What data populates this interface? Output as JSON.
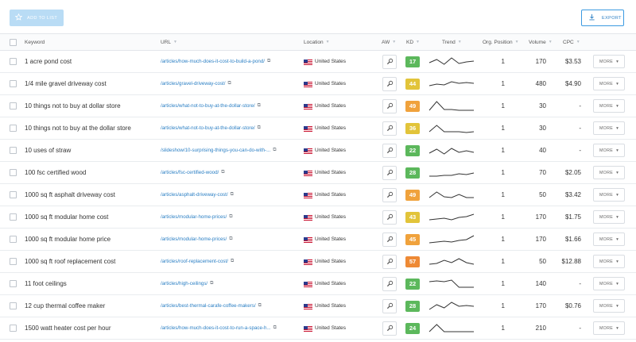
{
  "toolbar": {
    "add_label": "ADD TO LIST",
    "export_label": "EXPORT",
    "add_icon": "star-icon",
    "export_icon": "download-icon"
  },
  "columns": {
    "keyword": "Keyword",
    "url": "URL",
    "location": "Location",
    "aw": "AW",
    "kd": "KD",
    "trend": "Trend",
    "position": "Org. Position",
    "volume": "Volume",
    "cpc": "CPC"
  },
  "colors": {
    "kd_green": "#5cb85c",
    "kd_yellow": "#e2c43a",
    "kd_orange": "#f0a23c",
    "kd_dark_orange": "#ee8a35",
    "link": "#2b7fc4"
  },
  "more_label": "MORE",
  "rows": [
    {
      "keyword": "1 acre pond cost",
      "url": "/articles/how-much-does-it-cost-to-build-a-pond/",
      "location": "United States",
      "kd": "17",
      "kd_color": "#5cb85c",
      "position": "1",
      "volume": "170",
      "cpc": "$3.53",
      "trend": [
        6,
        10,
        4,
        12,
        5,
        7,
        8
      ]
    },
    {
      "keyword": "1/4 mile gravel driveway cost",
      "url": "/articles/gravel-driveway-cost/",
      "location": "United States",
      "kd": "44",
      "kd_color": "#e2c43a",
      "position": "1",
      "volume": "480",
      "cpc": "$4.90",
      "trend": [
        5,
        7,
        6,
        10,
        8,
        9,
        8
      ]
    },
    {
      "keyword": "10 things not to buy at dollar store",
      "url": "/articles/what-not-to-buy-at-the-dollar-store/",
      "location": "United States",
      "kd": "49",
      "kd_color": "#f0a23c",
      "position": "1",
      "volume": "30",
      "cpc": "-",
      "trend": [
        2,
        13,
        3,
        3,
        2,
        2,
        2
      ]
    },
    {
      "keyword": "10 things not to buy at the dollar store",
      "url": "/articles/what-not-to-buy-at-the-dollar-store/",
      "location": "United States",
      "kd": "36",
      "kd_color": "#e2c43a",
      "position": "1",
      "volume": "30",
      "cpc": "-",
      "trend": [
        3,
        11,
        3,
        3,
        3,
        2,
        3
      ]
    },
    {
      "keyword": "10 uses of straw",
      "url": "/slideshow/10-surprising-things-you-can-do-with-...",
      "location": "United States",
      "kd": "22",
      "kd_color": "#5cb85c",
      "position": "1",
      "volume": "40",
      "cpc": "-",
      "trend": [
        4,
        9,
        3,
        10,
        5,
        7,
        5
      ]
    },
    {
      "keyword": "100 fsc certified wood",
      "url": "/articles/fsc-certified-wood/",
      "location": "United States",
      "kd": "28",
      "kd_color": "#5cb85c",
      "position": "1",
      "volume": "70",
      "cpc": "$2.05",
      "trend": [
        3,
        3,
        4,
        4,
        6,
        5,
        7
      ]
    },
    {
      "keyword": "1000 sq ft asphalt driveway cost",
      "url": "/articles/asphalt-driveway-cost/",
      "location": "United States",
      "kd": "49",
      "kd_color": "#f0a23c",
      "position": "1",
      "volume": "50",
      "cpc": "$3.42",
      "trend": [
        4,
        11,
        5,
        4,
        8,
        4,
        4
      ]
    },
    {
      "keyword": "1000 sq ft modular home cost",
      "url": "/articles/modular-home-prices/",
      "location": "United States",
      "kd": "43",
      "kd_color": "#e2c43a",
      "position": "1",
      "volume": "170",
      "cpc": "$1.75",
      "trend": [
        4,
        5,
        6,
        4,
        7,
        8,
        11
      ]
    },
    {
      "keyword": "1000 sq ft modular home price",
      "url": "/articles/modular-home-prices/",
      "location": "United States",
      "kd": "45",
      "kd_color": "#f0a23c",
      "position": "1",
      "volume": "170",
      "cpc": "$1.66",
      "trend": [
        3,
        4,
        5,
        4,
        6,
        7,
        12
      ]
    },
    {
      "keyword": "1000 sq ft roof replacement cost",
      "url": "/articles/roof-replacement-cost/",
      "location": "United States",
      "kd": "57",
      "kd_color": "#ee8a35",
      "position": "1",
      "volume": "50",
      "cpc": "$12.88",
      "trend": [
        4,
        5,
        9,
        6,
        11,
        6,
        4
      ]
    },
    {
      "keyword": "11 foot ceilings",
      "url": "/articles/high-ceilings/",
      "location": "United States",
      "kd": "22",
      "kd_color": "#5cb85c",
      "position": "1",
      "volume": "140",
      "cpc": "-",
      "trend": [
        10,
        11,
        10,
        12,
        3,
        3,
        3
      ]
    },
    {
      "keyword": "12 cup thermal coffee maker",
      "url": "/articles/best-thermal-carafe-coffee-makers/",
      "location": "United States",
      "kd": "28",
      "kd_color": "#5cb85c",
      "position": "1",
      "volume": "170",
      "cpc": "$0.76",
      "trend": [
        3,
        9,
        5,
        12,
        7,
        8,
        7
      ]
    },
    {
      "keyword": "1500 watt heater cost per hour",
      "url": "/articles/how-much-does-it-cost-to-run-a-space-h...",
      "location": "United States",
      "kd": "24",
      "kd_color": "#5cb85c",
      "position": "1",
      "volume": "210",
      "cpc": "-",
      "trend": [
        3,
        12,
        3,
        3,
        3,
        3,
        3
      ]
    }
  ]
}
